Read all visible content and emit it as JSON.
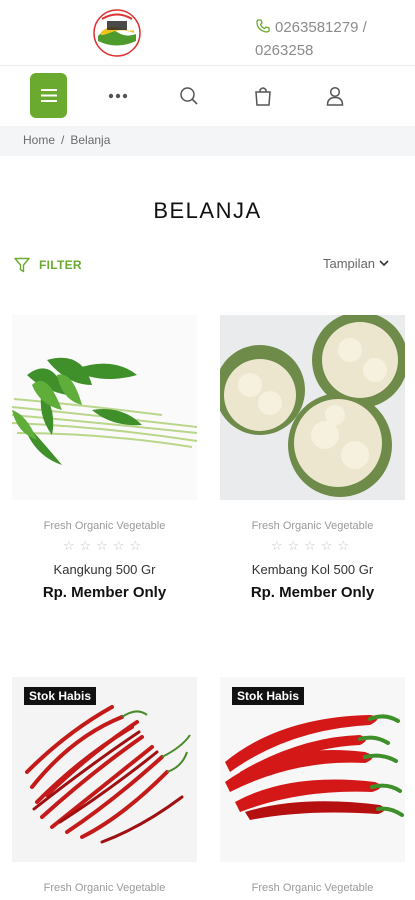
{
  "header": {
    "logo_alt": "logo",
    "phone_line1": "0263581279 /",
    "phone_line2": "0263258"
  },
  "breadcrumb": {
    "home": "Home",
    "separator": "/",
    "current": "Belanja"
  },
  "page": {
    "title": "BELANJA",
    "filter_label": "FILTER",
    "display_label": "Tampilan"
  },
  "products": [
    {
      "category": "Fresh Organic Vegetable",
      "stars": "☆☆☆☆☆",
      "name": "Kangkung 500 Gr",
      "price": "Rp. Member Only"
    },
    {
      "category": "Fresh Organic Vegetable",
      "stars": "☆☆☆☆☆",
      "name": "Kembang Kol 500 Gr",
      "price": "Rp. Member Only"
    },
    {
      "category": "Fresh Organic Vegetable",
      "badge": "Stok Habis"
    },
    {
      "category": "Fresh Organic Vegetable",
      "badge": "Stok Habis"
    }
  ],
  "colors": {
    "accent": "#6aaa2f"
  }
}
